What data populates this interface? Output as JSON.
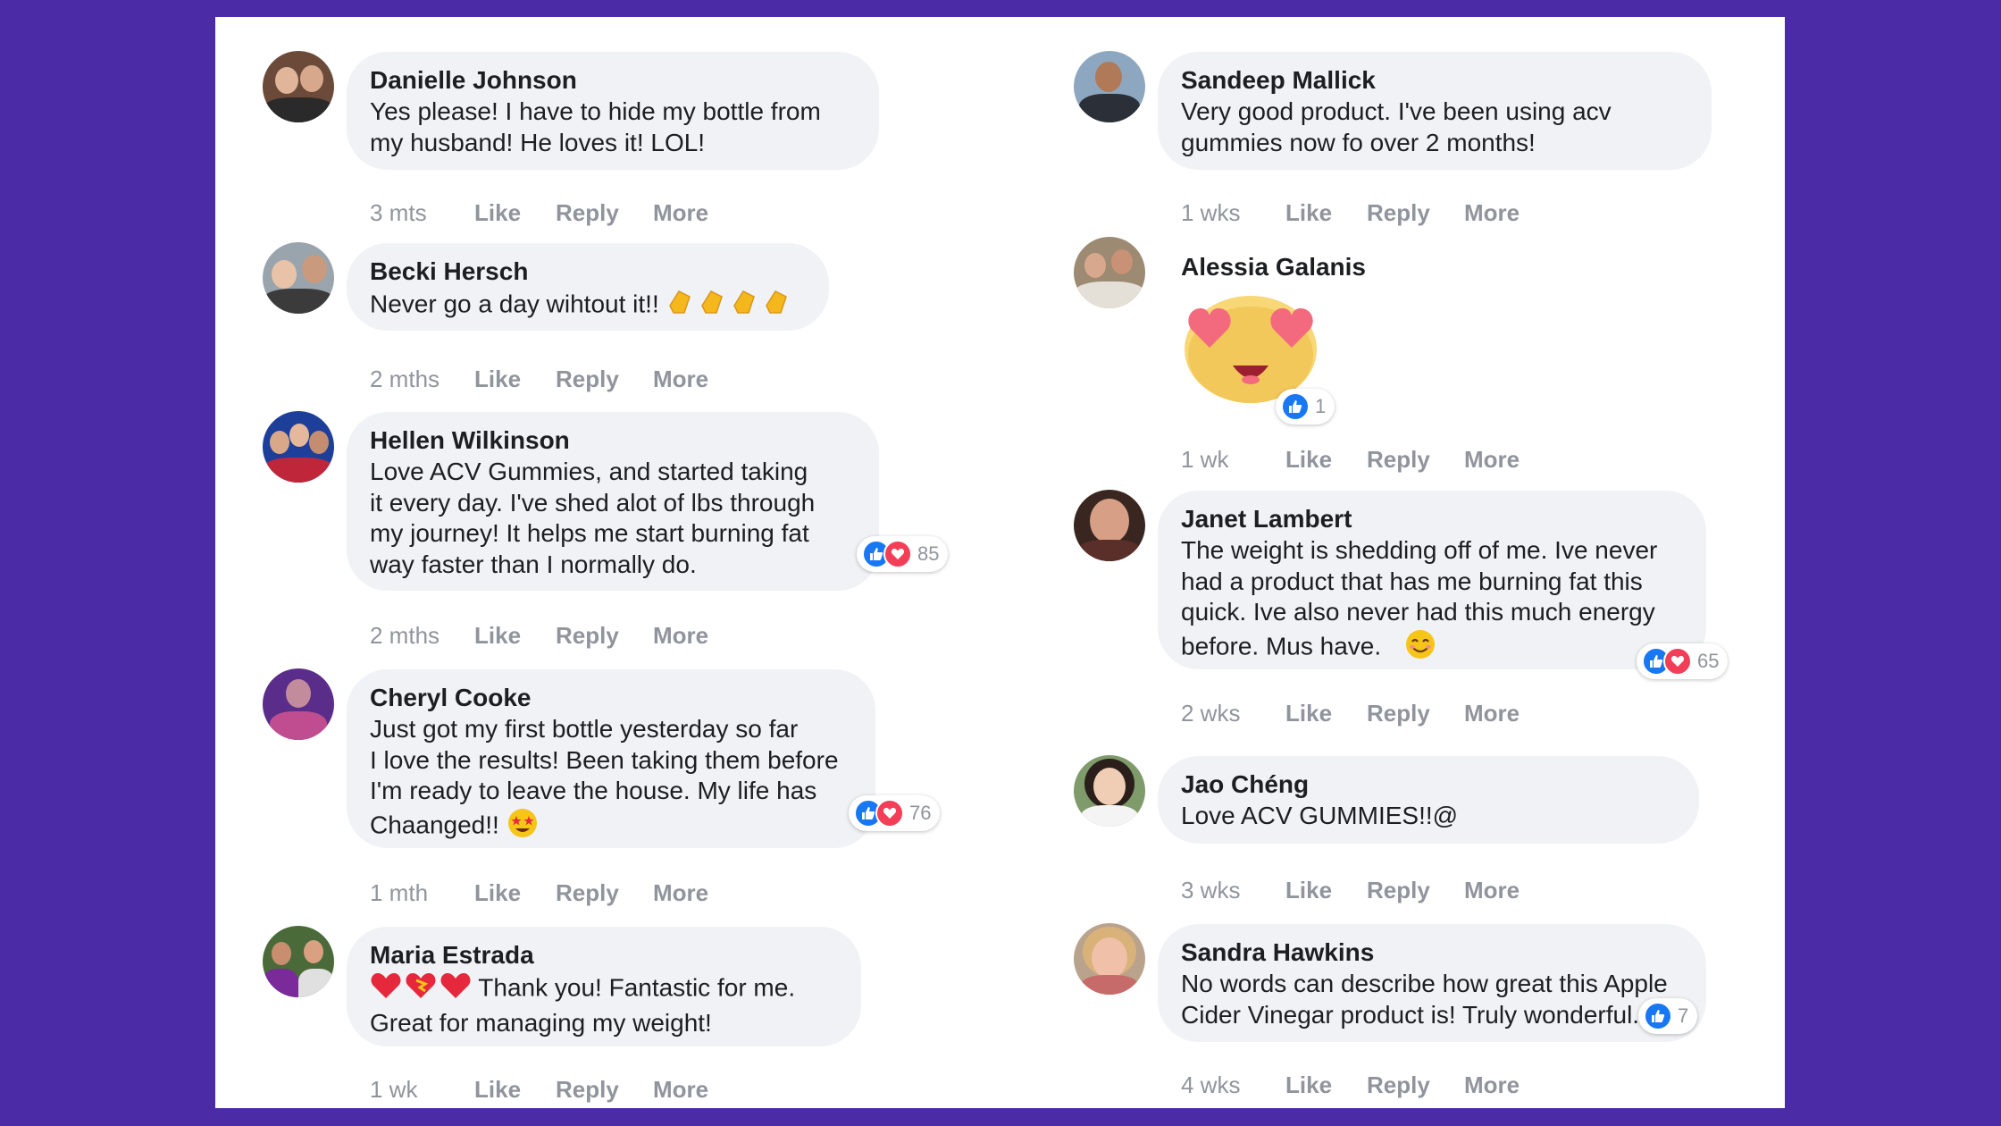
{
  "colors": {
    "background": "#4b2ba6",
    "like_blue": "#1877f2",
    "love_red": "#f33e58",
    "bubble": "#f0f2f5"
  },
  "actions": {
    "like": "Like",
    "reply": "Reply",
    "more": "More"
  },
  "comments": [
    {
      "name": "Danielle Johnson",
      "lines": [
        "Yes please! I have to hide my bottle from",
        "my husband! He loves it! LOL!"
      ],
      "time": "3 mts"
    },
    {
      "name": "Becki Hersch",
      "lines": [
        "Never go a day wihtout it!!"
      ],
      "time": "2 mths",
      "emoji": "clapping-hands-icon"
    },
    {
      "name": "Hellen Wilkinson",
      "lines": [
        "Love ACV Gummies, and started taking",
        "it every day. I've shed alot of lbs through",
        "my journey! It helps me start burning fat",
        "way faster than I normally do."
      ],
      "time": "2 mths",
      "reactions": "85"
    },
    {
      "name": "Cheryl Cooke",
      "lines": [
        "Just got my first bottle yesterday so far",
        "I love the results! Been taking them before",
        "I'm ready to leave the house. My life has",
        "Chaanged!!"
      ],
      "time": "1 mth",
      "reactions": "76",
      "emoji": "star-struck-icon"
    },
    {
      "name": "Maria Estrada",
      "lines": [
        "Thank you! Fantastic for me.",
        "Great for managing my weight!"
      ],
      "time": "1 wk",
      "emoji": "hearts-icon"
    },
    {
      "name": "Sandeep Mallick",
      "lines": [
        "Very good product. I've been using acv",
        "gummies now fo over 2 months!"
      ],
      "time": "1 wks"
    },
    {
      "name": "Alessia Galanis",
      "lines": [],
      "time": "1 wk",
      "reactions": "1",
      "emoji": "heart-eyes-sticker"
    },
    {
      "name": "Janet Lambert",
      "lines": [
        "The weight is shedding off of me. Ive never",
        "had a product that has me burning fat this",
        "quick. Ive also never had this much energy",
        "before. Mus have."
      ],
      "time": "2 wks",
      "reactions": "65",
      "emoji": "smiling-face-icon"
    },
    {
      "name": "Jao Chéng",
      "lines": [
        "Love ACV GUMMIES!!@"
      ],
      "time": "3 wks"
    },
    {
      "name": "Sandra Hawkins",
      "lines": [
        "No words can describe how great this Apple",
        "Cider Vinegar product is! Truly wonderful."
      ],
      "time": "4 wks",
      "reactions": "7"
    }
  ]
}
